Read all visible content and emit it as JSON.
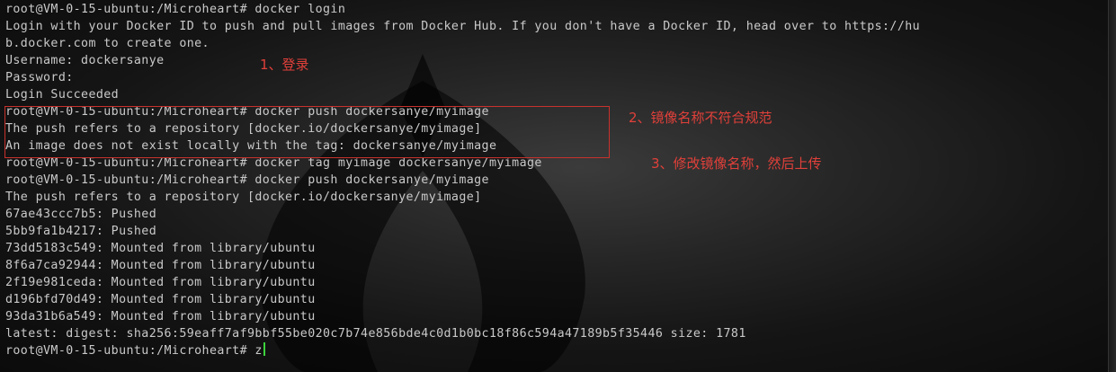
{
  "terminal": {
    "lines": [
      "root@VM-0-15-ubuntu:/Microheart# docker login",
      "Login with your Docker ID to push and pull images from Docker Hub. If you don't have a Docker ID, head over to https://hu",
      "b.docker.com to create one.",
      "Username: dockersanye",
      "Password:",
      "Login Succeeded",
      "root@VM-0-15-ubuntu:/Microheart# docker push dockersanye/myimage",
      "The push refers to a repository [docker.io/dockersanye/myimage]",
      "An image does not exist locally with the tag: dockersanye/myimage",
      "root@VM-0-15-ubuntu:/Microheart# docker tag myimage dockersanye/myimage",
      "root@VM-0-15-ubuntu:/Microheart# docker push dockersanye/myimage",
      "The push refers to a repository [docker.io/dockersanye/myimage]",
      "67ae43ccc7b5: Pushed",
      "5bb9fa1b4217: Pushed",
      "73dd5183c549: Mounted from library/ubuntu",
      "8f6a7ca92944: Mounted from library/ubuntu",
      "2f19e981ceda: Mounted from library/ubuntu",
      "d196bfd70d49: Mounted from library/ubuntu",
      "93da31b6a549: Mounted from library/ubuntu",
      "latest: digest: sha256:59eaff7af9bbf55be020c7b74e856bde4c0d1b0bc18f86c594a47189b5f35446 size: 1781"
    ],
    "prompt": "root@VM-0-15-ubuntu:/Microheart# ",
    "current_input": "z"
  },
  "annotations": {
    "step1": "1、登录",
    "step2": "2、镜像名称不符合规范",
    "step3": "3、修改镜像名称，然后上传"
  },
  "colors": {
    "text": "#c9c9c9",
    "annotation": "#e0403a",
    "highlight_box": "#c8312c",
    "cursor": "#3cd33c"
  }
}
